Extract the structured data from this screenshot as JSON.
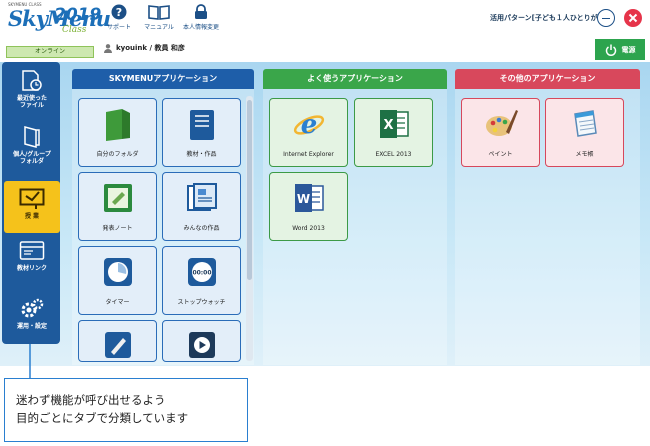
{
  "logo": {
    "brand_small": "SKYMENU CLASS",
    "brand_main": "SkyMenu",
    "brand_year": "2019",
    "brand_class": "Class"
  },
  "toolbar": {
    "support_label": "サポート",
    "manual_label": "マニュアル",
    "privacy_label": "本人情報変更"
  },
  "pattern_label": "活用パターン[子ども１人ひとりが使う]",
  "status": {
    "online_label": "オンライン"
  },
  "user": {
    "name": "kyouink / 教員 和彦"
  },
  "power": {
    "label": "電源"
  },
  "sidebar": {
    "items": [
      {
        "label": "最近使った\nファイル",
        "icon": "recent-files-icon"
      },
      {
        "label": "個人/グループ\nフォルダ",
        "icon": "folder-icon"
      },
      {
        "label": "授 業",
        "icon": "class-icon"
      },
      {
        "label": "教材リンク",
        "icon": "link-icon"
      },
      {
        "label": "運用・設定",
        "icon": "gear-icon"
      }
    ]
  },
  "panels": {
    "skymenu": {
      "title": "SKYMENUアプリケーション",
      "tiles": [
        "自分のフォルダ",
        "教材・作品",
        "発表ノート",
        "みんなの作品",
        "タイマー",
        "ストップウォッチ",
        "",
        ""
      ]
    },
    "frequent": {
      "title": "よく使うアプリケーション",
      "tiles": [
        "Internet Explorer",
        "EXCEL 2013",
        "Word 2013"
      ]
    },
    "other": {
      "title": "その他のアプリケーション",
      "tiles": [
        "ペイント",
        "メモ帳"
      ]
    }
  },
  "stopwatch_display": "00:00",
  "callout": {
    "line1": "迷わず機能が呼び出せるよう",
    "line2": "目的ごとにタブで分類しています"
  },
  "colors": {
    "accent_blue": "#1e5ea9",
    "accent_green": "#3aa64a",
    "accent_red": "#d8485c",
    "active_yellow": "#f5c21b"
  }
}
